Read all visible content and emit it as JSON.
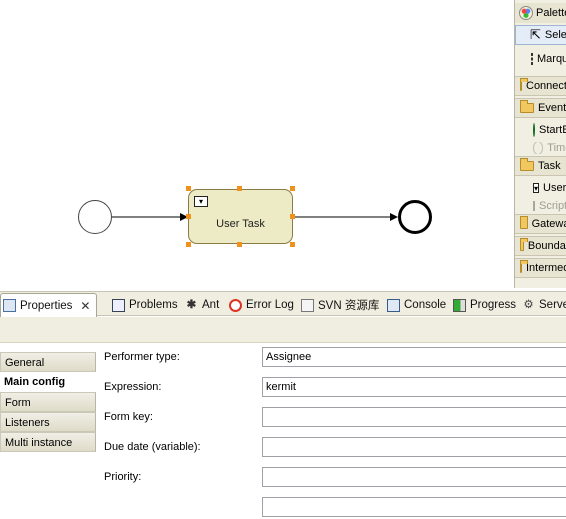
{
  "diagram": {
    "task_label": "User Task"
  },
  "palette": {
    "title": "Palette",
    "tools": [
      {
        "label": "Select",
        "icon": "arrow-pointer-icon"
      },
      {
        "label": "Marquee",
        "icon": "marquee-select-icon"
      }
    ],
    "drawers": {
      "connections": "Connections",
      "events": "Events",
      "start_event": "StartEvent",
      "timer": "Timer",
      "task": "Task",
      "user_task": "UserTask",
      "script_task": "ScriptTask",
      "gateway": "Gateway",
      "boundary": "Boundary",
      "intermediate": "Intermediate"
    }
  },
  "tabs": [
    {
      "label": "Properties",
      "icon": "properties-icon",
      "active": true
    },
    {
      "label": "Problems",
      "icon": "problems-icon"
    },
    {
      "label": "Ant",
      "icon": "ant-icon"
    },
    {
      "label": "Error Log",
      "icon": "error-log-icon"
    },
    {
      "label": "SVN 资源库",
      "icon": "svn-repository-icon"
    },
    {
      "label": "Console",
      "icon": "console-icon"
    },
    {
      "label": "Progress",
      "icon": "progress-icon"
    },
    {
      "label": "Servers",
      "icon": "servers-icon"
    }
  ],
  "properties": {
    "sidebar": [
      {
        "label": "General",
        "selected": false
      },
      {
        "label": "Main config",
        "selected": true
      },
      {
        "label": "Form",
        "selected": false
      },
      {
        "label": "Listeners",
        "selected": false
      },
      {
        "label": "Multi instance",
        "selected": false
      }
    ],
    "fields": [
      {
        "label": "Performer type:",
        "value": "Assignee"
      },
      {
        "label": "Expression:",
        "value": "kermit"
      },
      {
        "label": "Form key:",
        "value": ""
      },
      {
        "label": "Due date (variable):",
        "value": ""
      },
      {
        "label": "Priority:",
        "value": ""
      },
      {
        "label": "",
        "value": ""
      }
    ]
  },
  "colors": {
    "task_fill": "#ecebc5",
    "selection_handle": "#f2901c",
    "start_event_icon": "#2fb04a"
  }
}
